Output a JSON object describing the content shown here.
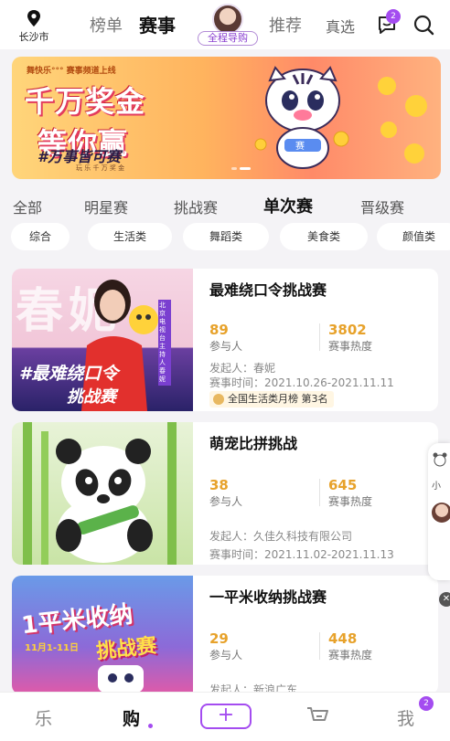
{
  "header": {
    "location": "长沙市",
    "tabs": [
      "榜单",
      "赛事",
      "推荐"
    ],
    "active_tab": "赛事",
    "guide_label": "全程导购",
    "zhenxuan": "真选",
    "message_badge": "2",
    "icons": [
      "location-pin-icon",
      "message-icon",
      "search-icon"
    ]
  },
  "banner": {
    "brand": "舞快乐°°° 赛事频道上线",
    "headline_1": "千万奖金",
    "headline_2": "等你赢",
    "slogan": "#万事皆可赛",
    "slogan_sub": "玩 乐 千 万 奖 金",
    "tiger_tag": "赛",
    "slides": 2,
    "active_slide": 1
  },
  "categories": [
    "全部",
    "明星赛",
    "挑战赛",
    "单次赛",
    "晋级赛"
  ],
  "active_category": "单次赛",
  "chips": [
    "综合",
    "生活类",
    "舞蹈类",
    "美食类",
    "颜值类"
  ],
  "active_chip": "生活类",
  "events": [
    {
      "title": "最难绕口令挑战赛",
      "participants": "89",
      "participants_label": "参与人",
      "heat": "3802",
      "heat_label": "赛事热度",
      "initiator": "发起人：春妮",
      "time": "赛事时间：2021.10.26-2021.11.11",
      "rank": "全国生活类月榜  第3名",
      "thumb_big": "春妮",
      "thumb_tag": "北京电视台主持人 春妮",
      "thumb_line1": "#最难绕口令",
      "thumb_line2": "挑战赛"
    },
    {
      "title": "萌宠比拼挑战",
      "participants": "38",
      "participants_label": "参与人",
      "heat": "645",
      "heat_label": "赛事热度",
      "initiator": "发起人：久佳久科技有限公司",
      "time": "赛事时间：2021.11.02-2021.11.13"
    },
    {
      "title": "一平米收纳挑战赛",
      "participants": "29",
      "participants_label": "参与人",
      "heat": "448",
      "heat_label": "赛事热度",
      "initiator": "发起人：新浪广东",
      "thumb_line1": "1平米收纳",
      "thumb_line2": "挑战赛",
      "thumb_sub": "11月1-11日"
    }
  ],
  "side_float": {
    "label": "小"
  },
  "bottom_nav": {
    "items": [
      "乐",
      "购",
      "+",
      "我"
    ],
    "active": "购",
    "me_badge": "2"
  },
  "colors": {
    "accent": "#a44cf0",
    "stat": "#e7a22b",
    "background": "#f4f3f6"
  }
}
